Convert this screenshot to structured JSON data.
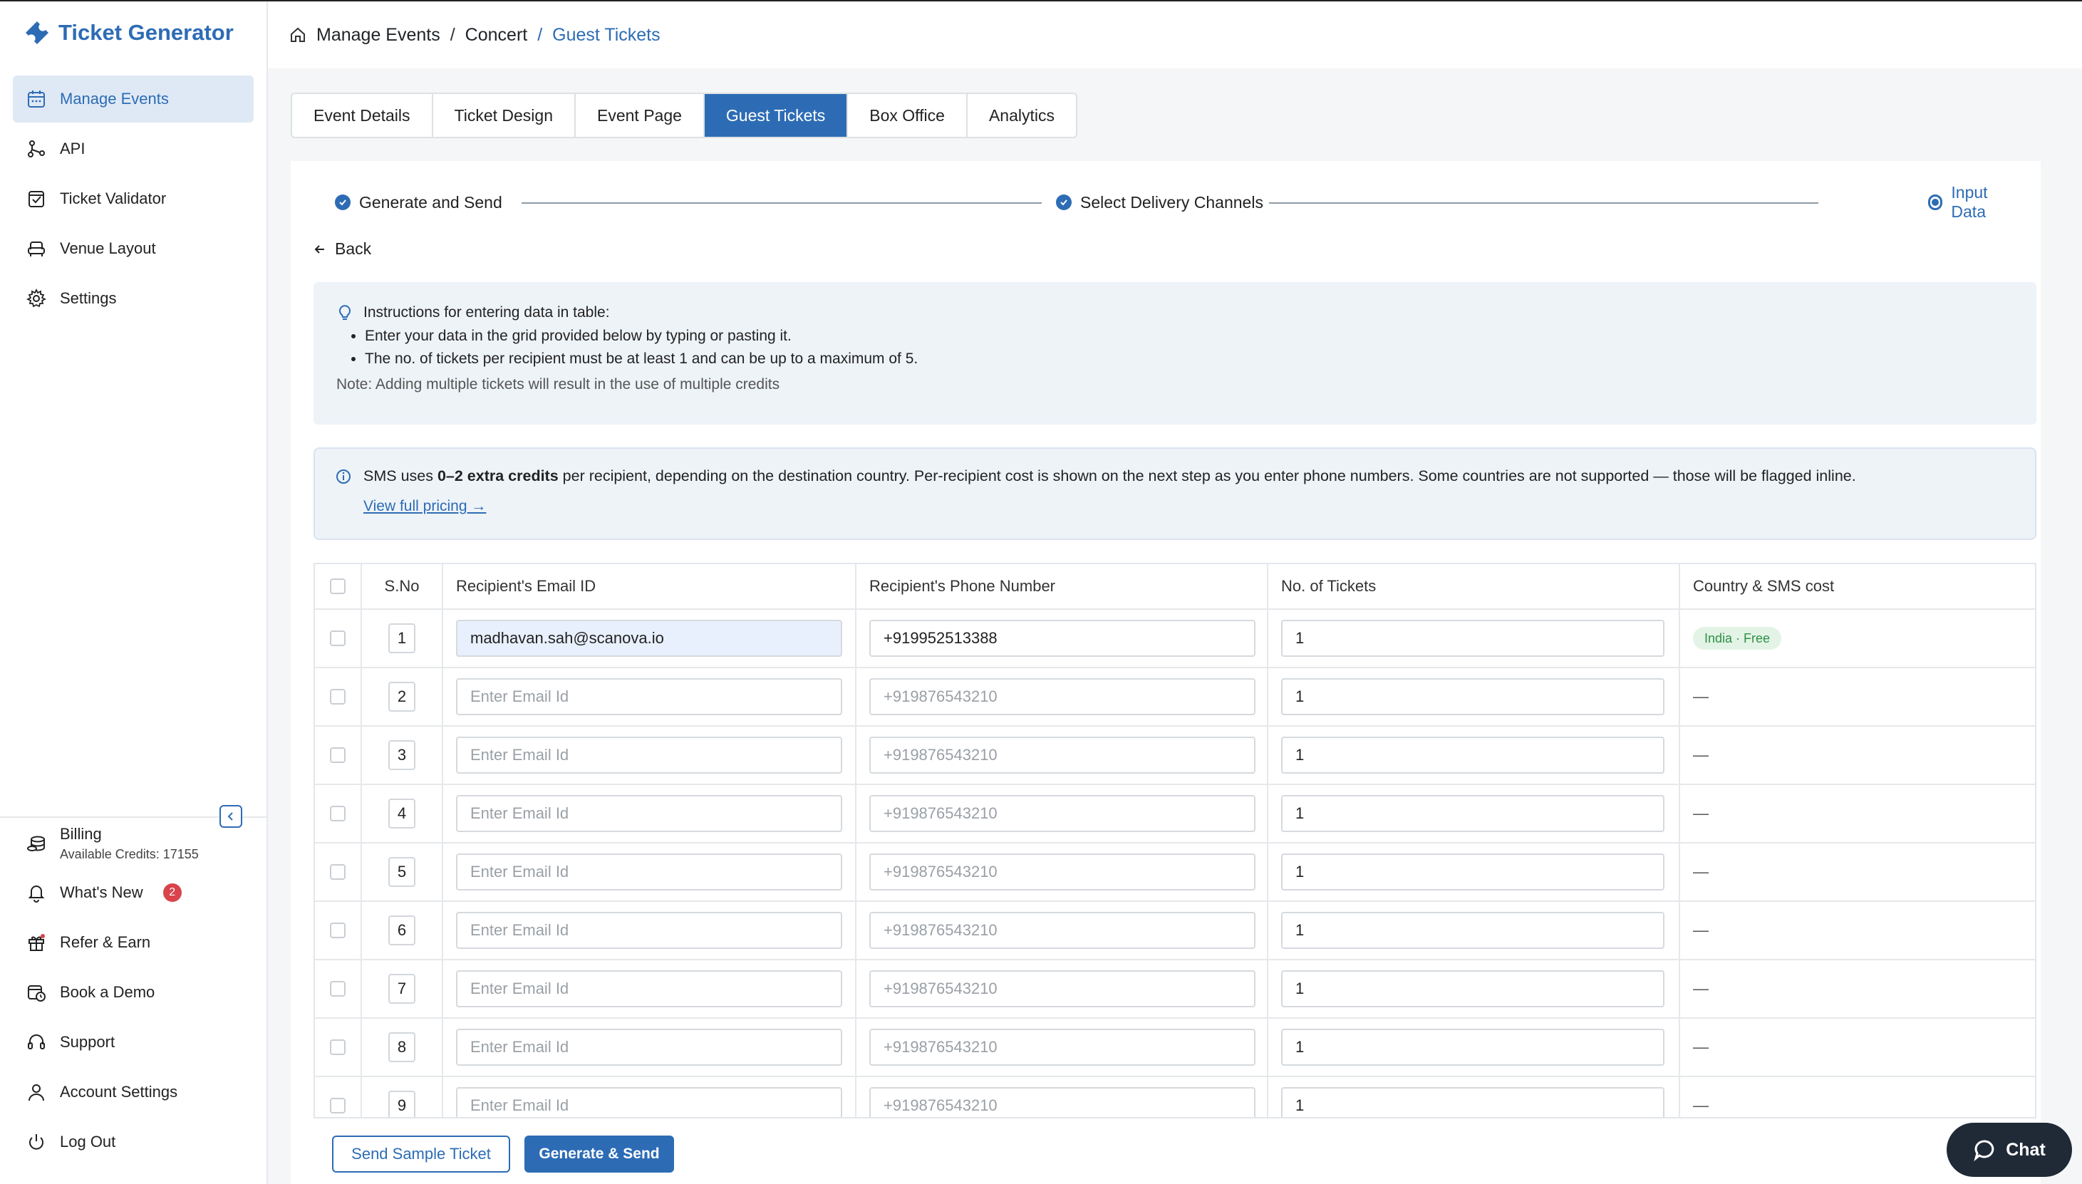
{
  "app": {
    "title": "Ticket Generator"
  },
  "sidebar": {
    "items": [
      {
        "label": "Manage Events",
        "icon": "calendar-icon",
        "active": true
      },
      {
        "label": "API",
        "icon": "api-icon"
      },
      {
        "label": "Ticket Validator",
        "icon": "validator-icon"
      },
      {
        "label": "Venue Layout",
        "icon": "seat-icon"
      },
      {
        "label": "Settings",
        "icon": "gear-icon"
      }
    ],
    "billing": {
      "label": "Billing",
      "credits": "Available Credits: 17155"
    },
    "whats_new": {
      "label": "What's New",
      "count": "2"
    },
    "bottom_items": [
      {
        "label": "Refer & Earn",
        "icon": "gift-icon"
      },
      {
        "label": "Book a Demo",
        "icon": "calendar-clock-icon"
      },
      {
        "label": "Support",
        "icon": "headset-icon"
      },
      {
        "label": "Account Settings",
        "icon": "user-icon"
      },
      {
        "label": "Log Out",
        "icon": "power-icon"
      }
    ]
  },
  "breadcrumb": {
    "part1": "Manage Events",
    "part2": "Concert",
    "current": "Guest Tickets",
    "sep": "/"
  },
  "tabs": [
    "Event Details",
    "Ticket Design",
    "Event Page",
    "Guest Tickets",
    "Box Office",
    "Analytics"
  ],
  "active_tab": "Guest Tickets",
  "stepper": {
    "step1": "Generate and Send",
    "step2": "Select Delivery Channels",
    "step3": "Input Data"
  },
  "back_label": "Back",
  "instructions": {
    "title": "Instructions for entering data in table:",
    "bullet1": "Enter your data in the grid provided below by typing or pasting it.",
    "bullet2": "The no. of tickets per recipient must be at least 1 and can be up to a maximum of 5.",
    "note": "Note: Adding multiple tickets will result in the use of multiple credits"
  },
  "sms_notice": {
    "prefix": "SMS uses ",
    "bold": "0–2 extra credits",
    "suffix": " per recipient, depending on the destination country. Per-recipient cost is shown on the next step as you enter phone numbers. Some countries are not supported — those will be flagged inline.",
    "link": "View full pricing →"
  },
  "table": {
    "headers": {
      "sno": "S.No",
      "email": "Recipient's Email ID",
      "phone": "Recipient's Phone Number",
      "tickets": "No. of Tickets",
      "country": "Country & SMS cost"
    },
    "email_placeholder": "Enter Email Id",
    "phone_placeholder": "+919876543210",
    "rows": [
      {
        "sno": "1",
        "email": "madhavan.sah@scanova.io",
        "phone": "+919952513388",
        "tickets": "1",
        "country": "India · Free"
      },
      {
        "sno": "2",
        "email": "",
        "phone": "",
        "tickets": "1",
        "country": "—"
      },
      {
        "sno": "3",
        "email": "",
        "phone": "",
        "tickets": "1",
        "country": "—"
      },
      {
        "sno": "4",
        "email": "",
        "phone": "",
        "tickets": "1",
        "country": "—"
      },
      {
        "sno": "5",
        "email": "",
        "phone": "",
        "tickets": "1",
        "country": "—"
      },
      {
        "sno": "6",
        "email": "",
        "phone": "",
        "tickets": "1",
        "country": "—"
      },
      {
        "sno": "7",
        "email": "",
        "phone": "",
        "tickets": "1",
        "country": "—"
      },
      {
        "sno": "8",
        "email": "",
        "phone": "",
        "tickets": "1",
        "country": "—"
      },
      {
        "sno": "9",
        "email": "",
        "phone": "",
        "tickets": "1",
        "country": "—"
      }
    ]
  },
  "buttons": {
    "send_sample": "Send Sample Ticket",
    "generate_send": "Generate & Send"
  },
  "chat_label": "Chat",
  "colors": {
    "accent": "#2d6cb5",
    "badge_red": "#d9434b",
    "tag_green_bg": "#e3f3e6",
    "tag_green_text": "#2f8f46"
  }
}
